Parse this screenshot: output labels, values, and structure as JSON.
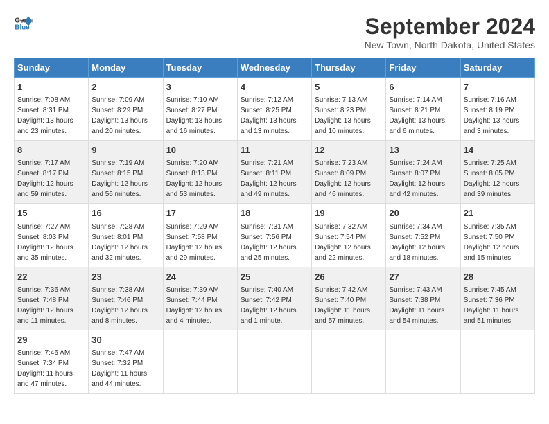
{
  "logo": {
    "line1": "General",
    "line2": "Blue"
  },
  "title": "September 2024",
  "subtitle": "New Town, North Dakota, United States",
  "days_header": [
    "Sunday",
    "Monday",
    "Tuesday",
    "Wednesday",
    "Thursday",
    "Friday",
    "Saturday"
  ],
  "weeks": [
    [
      {
        "day": "1",
        "info": "Sunrise: 7:08 AM\nSunset: 8:31 PM\nDaylight: 13 hours\nand 23 minutes."
      },
      {
        "day": "2",
        "info": "Sunrise: 7:09 AM\nSunset: 8:29 PM\nDaylight: 13 hours\nand 20 minutes."
      },
      {
        "day": "3",
        "info": "Sunrise: 7:10 AM\nSunset: 8:27 PM\nDaylight: 13 hours\nand 16 minutes."
      },
      {
        "day": "4",
        "info": "Sunrise: 7:12 AM\nSunset: 8:25 PM\nDaylight: 13 hours\nand 13 minutes."
      },
      {
        "day": "5",
        "info": "Sunrise: 7:13 AM\nSunset: 8:23 PM\nDaylight: 13 hours\nand 10 minutes."
      },
      {
        "day": "6",
        "info": "Sunrise: 7:14 AM\nSunset: 8:21 PM\nDaylight: 13 hours\nand 6 minutes."
      },
      {
        "day": "7",
        "info": "Sunrise: 7:16 AM\nSunset: 8:19 PM\nDaylight: 13 hours\nand 3 minutes."
      }
    ],
    [
      {
        "day": "8",
        "info": "Sunrise: 7:17 AM\nSunset: 8:17 PM\nDaylight: 12 hours\nand 59 minutes."
      },
      {
        "day": "9",
        "info": "Sunrise: 7:19 AM\nSunset: 8:15 PM\nDaylight: 12 hours\nand 56 minutes."
      },
      {
        "day": "10",
        "info": "Sunrise: 7:20 AM\nSunset: 8:13 PM\nDaylight: 12 hours\nand 53 minutes."
      },
      {
        "day": "11",
        "info": "Sunrise: 7:21 AM\nSunset: 8:11 PM\nDaylight: 12 hours\nand 49 minutes."
      },
      {
        "day": "12",
        "info": "Sunrise: 7:23 AM\nSunset: 8:09 PM\nDaylight: 12 hours\nand 46 minutes."
      },
      {
        "day": "13",
        "info": "Sunrise: 7:24 AM\nSunset: 8:07 PM\nDaylight: 12 hours\nand 42 minutes."
      },
      {
        "day": "14",
        "info": "Sunrise: 7:25 AM\nSunset: 8:05 PM\nDaylight: 12 hours\nand 39 minutes."
      }
    ],
    [
      {
        "day": "15",
        "info": "Sunrise: 7:27 AM\nSunset: 8:03 PM\nDaylight: 12 hours\nand 35 minutes."
      },
      {
        "day": "16",
        "info": "Sunrise: 7:28 AM\nSunset: 8:01 PM\nDaylight: 12 hours\nand 32 minutes."
      },
      {
        "day": "17",
        "info": "Sunrise: 7:29 AM\nSunset: 7:58 PM\nDaylight: 12 hours\nand 29 minutes."
      },
      {
        "day": "18",
        "info": "Sunrise: 7:31 AM\nSunset: 7:56 PM\nDaylight: 12 hours\nand 25 minutes."
      },
      {
        "day": "19",
        "info": "Sunrise: 7:32 AM\nSunset: 7:54 PM\nDaylight: 12 hours\nand 22 minutes."
      },
      {
        "day": "20",
        "info": "Sunrise: 7:34 AM\nSunset: 7:52 PM\nDaylight: 12 hours\nand 18 minutes."
      },
      {
        "day": "21",
        "info": "Sunrise: 7:35 AM\nSunset: 7:50 PM\nDaylight: 12 hours\nand 15 minutes."
      }
    ],
    [
      {
        "day": "22",
        "info": "Sunrise: 7:36 AM\nSunset: 7:48 PM\nDaylight: 12 hours\nand 11 minutes."
      },
      {
        "day": "23",
        "info": "Sunrise: 7:38 AM\nSunset: 7:46 PM\nDaylight: 12 hours\nand 8 minutes."
      },
      {
        "day": "24",
        "info": "Sunrise: 7:39 AM\nSunset: 7:44 PM\nDaylight: 12 hours\nand 4 minutes."
      },
      {
        "day": "25",
        "info": "Sunrise: 7:40 AM\nSunset: 7:42 PM\nDaylight: 12 hours\nand 1 minute."
      },
      {
        "day": "26",
        "info": "Sunrise: 7:42 AM\nSunset: 7:40 PM\nDaylight: 11 hours\nand 57 minutes."
      },
      {
        "day": "27",
        "info": "Sunrise: 7:43 AM\nSunset: 7:38 PM\nDaylight: 11 hours\nand 54 minutes."
      },
      {
        "day": "28",
        "info": "Sunrise: 7:45 AM\nSunset: 7:36 PM\nDaylight: 11 hours\nand 51 minutes."
      }
    ],
    [
      {
        "day": "29",
        "info": "Sunrise: 7:46 AM\nSunset: 7:34 PM\nDaylight: 11 hours\nand 47 minutes."
      },
      {
        "day": "30",
        "info": "Sunrise: 7:47 AM\nSunset: 7:32 PM\nDaylight: 11 hours\nand 44 minutes."
      },
      {
        "day": "",
        "info": ""
      },
      {
        "day": "",
        "info": ""
      },
      {
        "day": "",
        "info": ""
      },
      {
        "day": "",
        "info": ""
      },
      {
        "day": "",
        "info": ""
      }
    ]
  ]
}
